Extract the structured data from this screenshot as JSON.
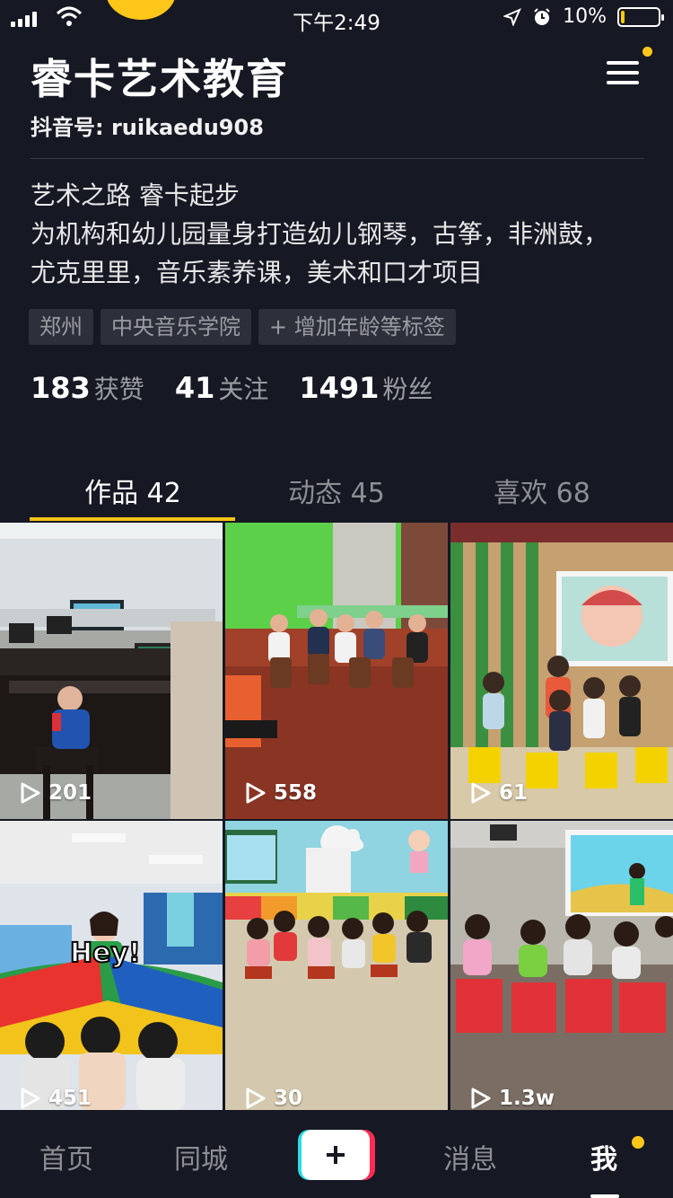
{
  "status_bar": {
    "time": "下午2:49",
    "battery": "10%",
    "battery_level": 0.1
  },
  "profile": {
    "name": "睿卡艺术教育",
    "douyin_id": "抖音号: ruikaedu908",
    "bio_line1": "艺术之路 睿卡起步",
    "bio_line2": "为机构和幼儿园量身打造幼儿钢琴，古筝，非洲鼓，尤克里里，音乐素养课，美术和口才项目",
    "tags": [
      "郑州",
      "中央音乐学院",
      "+ 增加年龄等标签"
    ],
    "stats": [
      {
        "num": "183",
        "label": "获赞"
      },
      {
        "num": "41",
        "label": "关注"
      },
      {
        "num": "1491",
        "label": "粉丝"
      }
    ]
  },
  "tabs": [
    {
      "label": "作品 42",
      "active": true
    },
    {
      "label": "动态 45",
      "active": false
    },
    {
      "label": "喜欢 68",
      "active": false
    }
  ],
  "videos": [
    {
      "plays": "201",
      "scene": "piano-classroom"
    },
    {
      "plays": "558",
      "scene": "drum-class"
    },
    {
      "plays": "61",
      "scene": "stage-performance"
    },
    {
      "plays": "451",
      "scene": "parachute-game",
      "caption": "Hey!"
    },
    {
      "plays": "30",
      "scene": "kids-seated"
    },
    {
      "plays": "1.3w",
      "scene": "kids-dancing"
    }
  ],
  "bottom_nav": {
    "home": "首页",
    "nearby": "同城",
    "messages": "消息",
    "me": "我"
  },
  "colors": {
    "background": "#161823",
    "accent": "#f9c316",
    "notification_dot": "#ffc61a"
  }
}
